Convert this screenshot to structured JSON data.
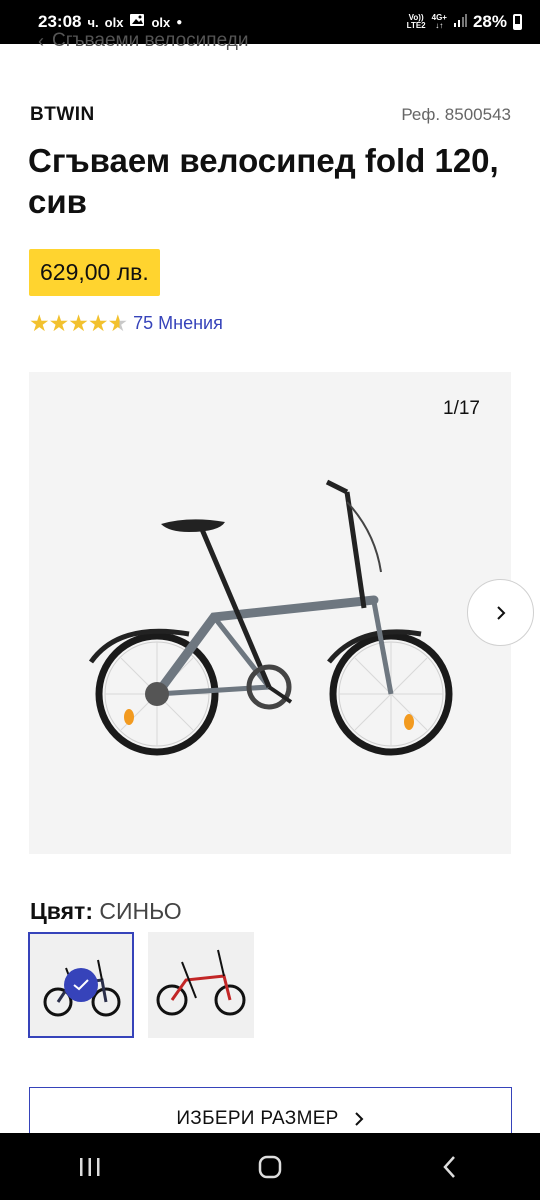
{
  "status_bar": {
    "time": "23:08",
    "time_suffix": "ч.",
    "volte_top": "Vo))",
    "volte_bottom": "LTE2",
    "network_top": "4G+",
    "network_bottom": "↓↑",
    "battery": "28%"
  },
  "breadcrumb": {
    "label": "Сгъваеми велосипеди"
  },
  "product": {
    "brand": "BTWIN",
    "ref": "Реф. 8500543",
    "title": "Сгъваем велосипед fold 120, сив",
    "price": "629,00 лв.",
    "rating": 4.5,
    "reviews": "75 Мнения"
  },
  "gallery": {
    "counter": "1/17"
  },
  "color": {
    "label": "Цвят:",
    "value": "СИНЬО",
    "swatches": [
      {
        "name": "blue",
        "frame_color": "#2b2f4a",
        "selected": true
      },
      {
        "name": "red",
        "frame_color": "#c22626",
        "selected": false
      }
    ]
  },
  "size_button": {
    "label": "ИЗБЕРИ РАЗМЕР"
  },
  "colors": {
    "accent": "#3643ba",
    "price_bg": "#ffd42f",
    "star": "#f2c12e",
    "bike_frame": "#6e7780"
  }
}
